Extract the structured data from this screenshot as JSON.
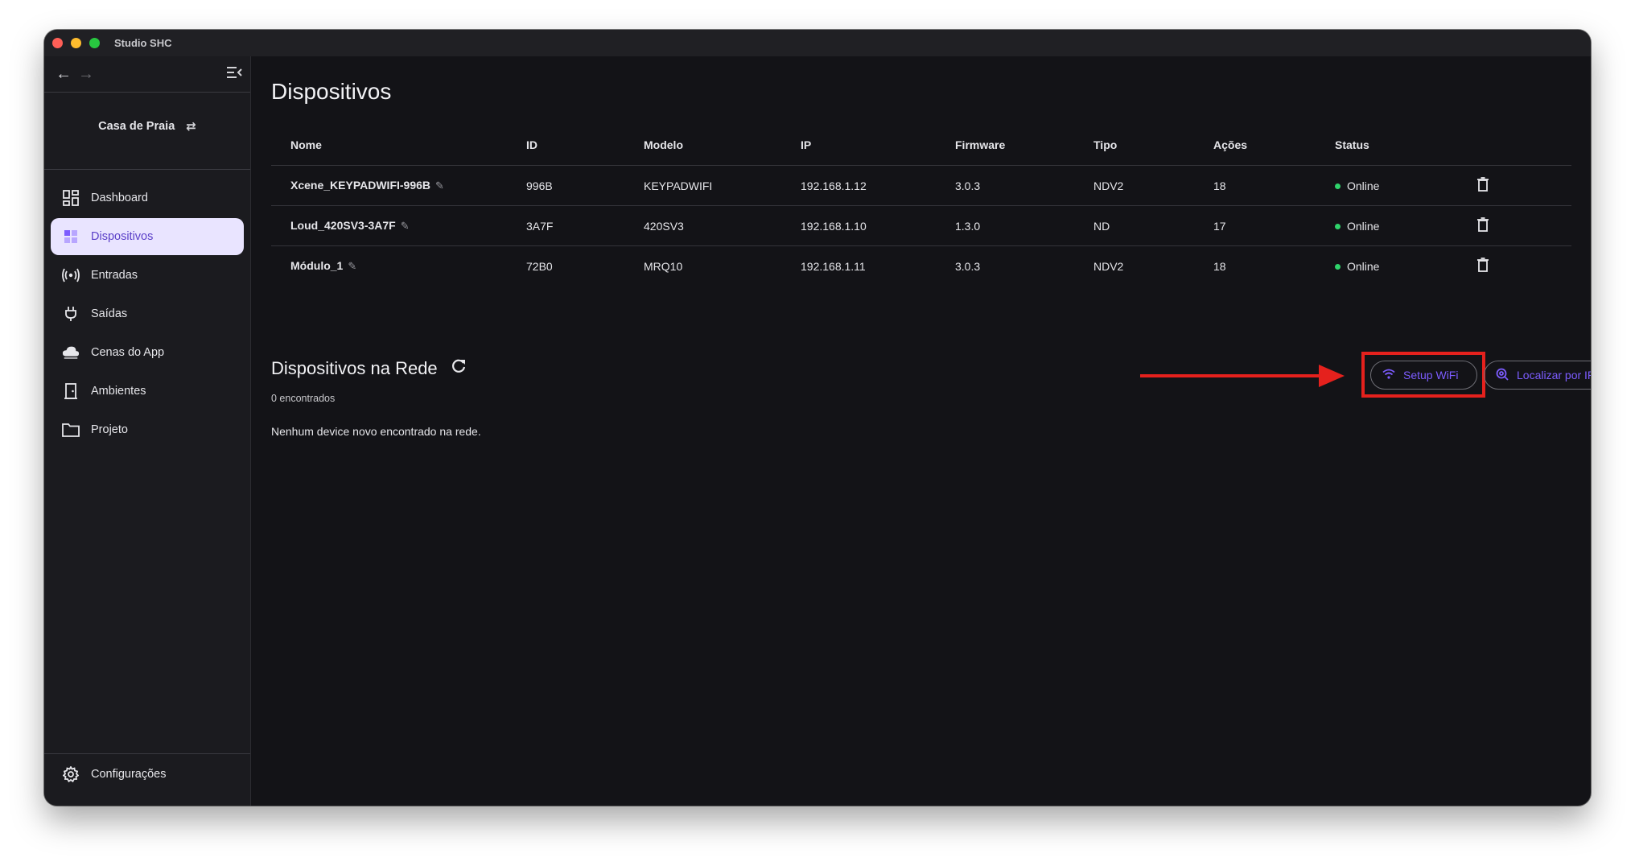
{
  "window": {
    "title": "Studio SHC"
  },
  "sidebar": {
    "project_name": "Casa de Praia",
    "items": [
      {
        "label": "Dashboard",
        "icon": "dashboard-icon"
      },
      {
        "label": "Dispositivos",
        "icon": "devices-grid-icon",
        "active": true
      },
      {
        "label": "Entradas",
        "icon": "broadcast-icon"
      },
      {
        "label": "Saídas",
        "icon": "plug-icon"
      },
      {
        "label": "Cenas do App",
        "icon": "cloud-icon"
      },
      {
        "label": "Ambientes",
        "icon": "door-icon"
      },
      {
        "label": "Projeto",
        "icon": "folder-icon"
      }
    ],
    "settings_label": "Configurações"
  },
  "main": {
    "title": "Dispositivos",
    "table": {
      "headers": [
        "Nome",
        "ID",
        "Modelo",
        "IP",
        "Firmware",
        "Tipo",
        "Ações",
        "Status"
      ],
      "rows": [
        {
          "nome": "Xcene_KEYPADWIFI-996B",
          "id": "996B",
          "modelo": "KEYPADWIFI",
          "ip": "192.168.1.12",
          "firmware": "3.0.3",
          "tipo": "NDV2",
          "acoes": "18",
          "status": "Online"
        },
        {
          "nome": "Loud_420SV3-3A7F",
          "id": "3A7F",
          "modelo": "420SV3",
          "ip": "192.168.1.10",
          "firmware": "1.3.0",
          "tipo": "ND",
          "acoes": "17",
          "status": "Online"
        },
        {
          "nome": "Módulo_1",
          "id": "72B0",
          "modelo": "MRQ10",
          "ip": "192.168.1.11",
          "firmware": "3.0.3",
          "tipo": "NDV2",
          "acoes": "18",
          "status": "Online"
        }
      ]
    },
    "network": {
      "title": "Dispositivos na Rede",
      "count": "0 encontrados",
      "empty_message": "Nenhum device novo encontrado na rede.",
      "setup_wifi_label": "Setup WiFi",
      "find_by_ip_label": "Localizar por IP"
    }
  },
  "colors": {
    "accent": "#7c5cff",
    "active_bg": "#e9e4ff",
    "online": "#2fd36b",
    "annotation": "#e5211d"
  }
}
